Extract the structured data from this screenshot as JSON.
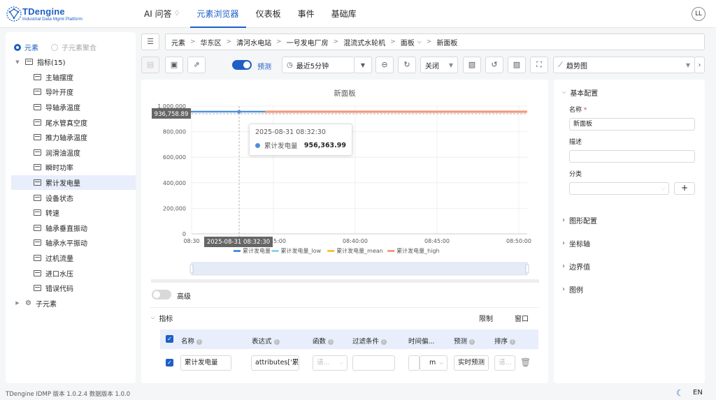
{
  "brand": {
    "title": "TDengine",
    "subtitle": "Industrial Data Mgmt Platform"
  },
  "nav": {
    "items": [
      {
        "label": "AI 问答"
      },
      {
        "label": "元素浏览器",
        "active": true
      },
      {
        "label": "仪表板"
      },
      {
        "label": "事件"
      },
      {
        "label": "基础库"
      }
    ],
    "user_initials": "LL"
  },
  "sidebar": {
    "radio_elements": "元素",
    "radio_aggregate": "子元素聚合",
    "metrics_group": "指标(15)",
    "metrics": [
      "主轴摆度",
      "导叶开度",
      "导轴承温度",
      "尾水管真空度",
      "推力轴承温度",
      "润滑油温度",
      "瞬时功率",
      "累计发电量",
      "设备状态",
      "转速",
      "轴承垂直振动",
      "轴承水平振动",
      "过机流量",
      "进口水压",
      "错误代码"
    ],
    "selected_metric": "累计发电量",
    "children_group": "子元素"
  },
  "breadcrumb": [
    "元素",
    "华东区",
    "清河水电站",
    "一号发电厂房",
    "混流式水轮机",
    "面板",
    "新面板"
  ],
  "toolbar": {
    "forecast_label": "预测",
    "time_range": "最近5分钟",
    "refresh_mode": "关闭",
    "chart_type": "趋势图"
  },
  "chart_data": {
    "type": "line",
    "title": "新面板",
    "x_ticks": [
      "08:30",
      "08:35:00",
      "08:40:00",
      "08:45:00",
      "08:50:00"
    ],
    "y_ticks": [
      "0",
      "200,000",
      "400,000",
      "600,000",
      "800,000",
      "1,000,000"
    ],
    "ylim": [
      0,
      1000000
    ],
    "series": [
      {
        "name": "累计发电量",
        "color": "#4e8fd6",
        "values": [
          956363.99,
          956363.99,
          956363.99
        ]
      },
      {
        "name": "累计发电量_low",
        "color": "#8fd3e8",
        "values": []
      },
      {
        "name": "累计发电量_mean",
        "color": "#f5c342",
        "values": []
      },
      {
        "name": "累计发电量_high",
        "color": "#f29a7c",
        "values": [
          956363.99,
          956363.99
        ]
      }
    ],
    "crosshair_y_label": "936,758.89",
    "crosshair_x_label": "2025-08-31 08:32:30",
    "tooltip": {
      "time": "2025-08-31 08:32:30",
      "series": "累计发电量",
      "value": "956,363.99"
    }
  },
  "advanced": {
    "label": "高级"
  },
  "metrics_section": {
    "title": "指标",
    "limit_label": "限制",
    "window_label": "窗口",
    "columns": [
      "名称",
      "表达式",
      "函数",
      "过滤条件",
      "时间偏...",
      "预测",
      "排序"
    ],
    "row": {
      "name": "累计发电量",
      "expression": "attributes['累",
      "func_placeholder": "请...",
      "time_unit": "m",
      "forecast": "实时预测",
      "sort_placeholder": "请..."
    }
  },
  "config": {
    "basic_title": "基本配置",
    "name_label": "名称",
    "name_value": "新面板",
    "desc_label": "描述",
    "category_label": "分类",
    "graph_title": "图形配置",
    "axis_title": "坐标轴",
    "boundary_title": "边界值",
    "legend_title": "图例"
  },
  "footer": {
    "version": "TDengine IDMP 版本 1.0.2.4 数据版本 1.0.0",
    "lang": "EN"
  }
}
